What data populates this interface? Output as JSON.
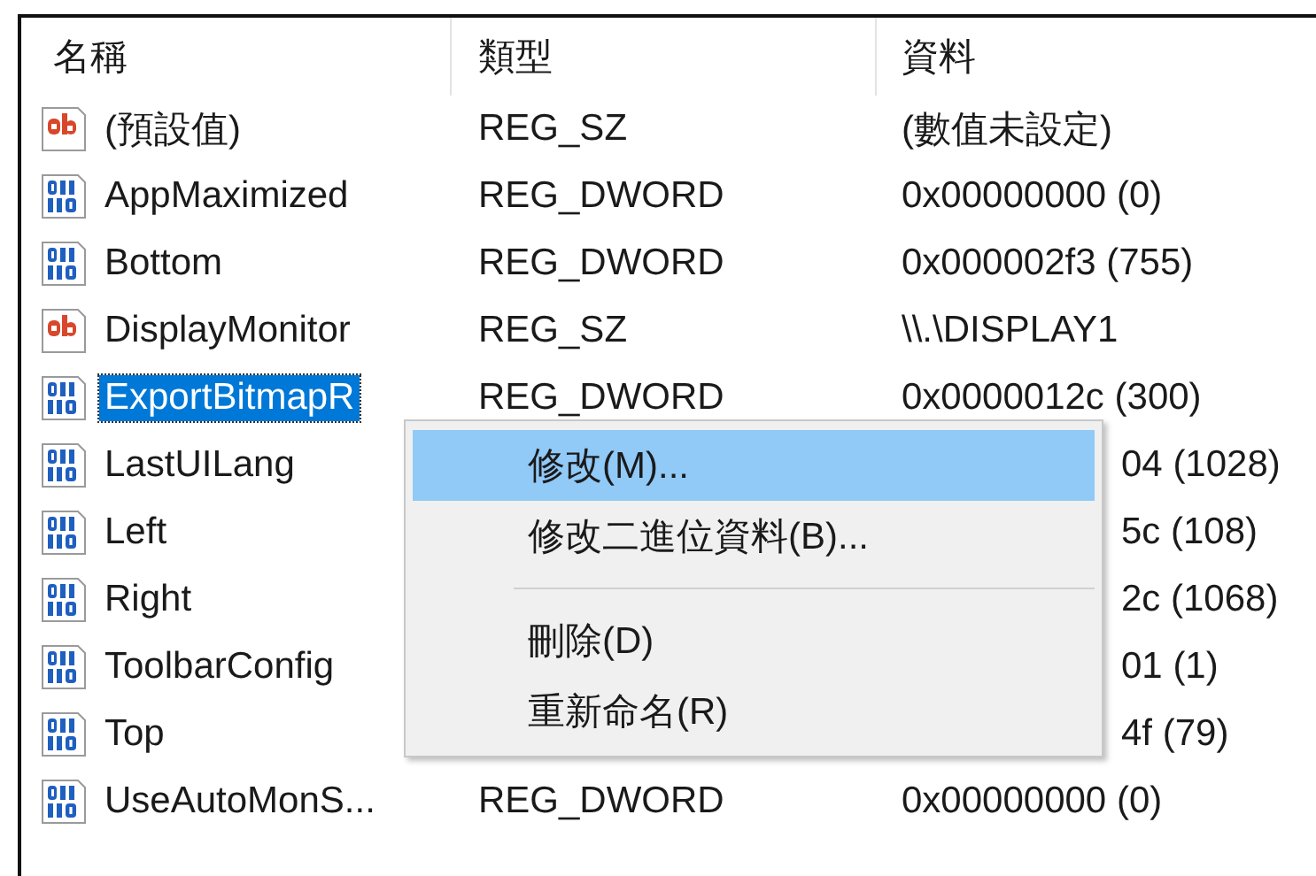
{
  "columns": [
    {
      "label": "名稱"
    },
    {
      "label": "類型"
    },
    {
      "label": "資料"
    }
  ],
  "rows": [
    {
      "kind": "string",
      "name": "(預設值)",
      "type": "REG_SZ",
      "data": "(數值未設定)",
      "selected": false
    },
    {
      "kind": "binary",
      "name": "AppMaximized",
      "type": "REG_DWORD",
      "data": "0x00000000 (0)",
      "selected": false
    },
    {
      "kind": "binary",
      "name": "Bottom",
      "type": "REG_DWORD",
      "data": "0x000002f3 (755)",
      "selected": false
    },
    {
      "kind": "string",
      "name": "DisplayMonitor",
      "type": "REG_SZ",
      "data": "\\\\.\\DISPLAY1",
      "selected": false
    },
    {
      "kind": "binary",
      "name": "ExportBitmapR",
      "type": "REG_DWORD",
      "data": "0x0000012c (300)",
      "selected": true
    },
    {
      "kind": "binary",
      "name": "LastUILang",
      "data": "04 (1028)",
      "cut": true,
      "selected": false
    },
    {
      "kind": "binary",
      "name": "Left",
      "data": "5c (108)",
      "cut": true,
      "selected": false
    },
    {
      "kind": "binary",
      "name": "Right",
      "data": "2c (1068)",
      "cut": true,
      "selected": false
    },
    {
      "kind": "binary",
      "name": "ToolbarConfig",
      "data": "01 (1)",
      "cut": true,
      "selected": false
    },
    {
      "kind": "binary",
      "name": "Top",
      "data": "4f (79)",
      "cut": true,
      "selected": false
    },
    {
      "kind": "binary",
      "name": "UseAutoMonS...",
      "type": "REG_DWORD",
      "data": "0x00000000 (0)",
      "selected": false
    }
  ],
  "context_menu": {
    "items": [
      {
        "kind": "item",
        "label": "修改(M)...",
        "selected": true
      },
      {
        "kind": "item",
        "label": "修改二進位資料(B)...",
        "selected": false
      },
      {
        "kind": "separator"
      },
      {
        "kind": "item",
        "label": "刪除(D)",
        "selected": false
      },
      {
        "kind": "item",
        "label": "重新命名(R)",
        "selected": false
      }
    ]
  }
}
